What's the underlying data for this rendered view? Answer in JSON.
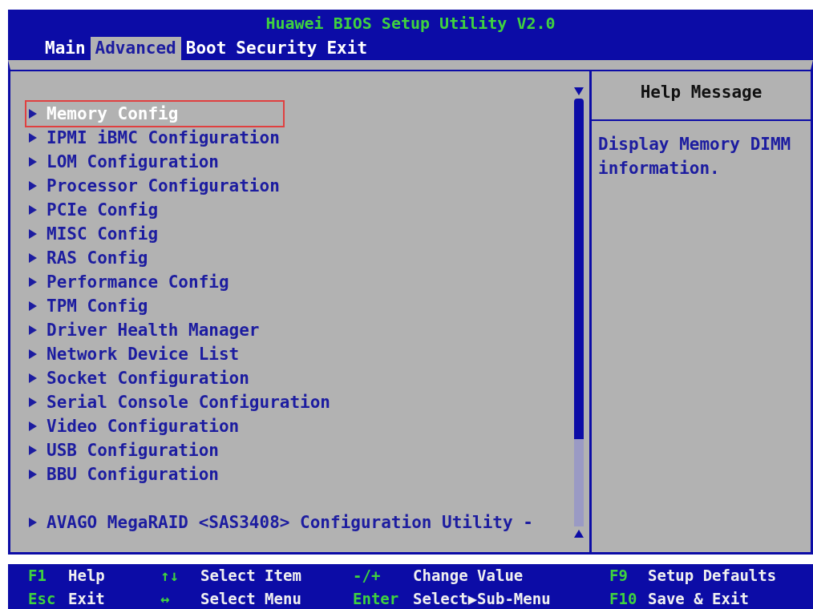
{
  "window": {
    "title": "Huawei BIOS Setup Utility V2.0"
  },
  "tabs": [
    {
      "label": "Main",
      "selected": false
    },
    {
      "label": "Advanced",
      "selected": true
    },
    {
      "label": "Boot",
      "selected": false
    },
    {
      "label": "Security",
      "selected": false
    },
    {
      "label": "Exit",
      "selected": false
    }
  ],
  "menu": {
    "items": [
      {
        "label": "Memory Config",
        "selected": true
      },
      {
        "label": "IPMI iBMC Configuration",
        "selected": false
      },
      {
        "label": "LOM Configuration",
        "selected": false
      },
      {
        "label": "Processor Configuration",
        "selected": false
      },
      {
        "label": "PCIe Config",
        "selected": false
      },
      {
        "label": "MISC Config",
        "selected": false
      },
      {
        "label": "RAS Config",
        "selected": false
      },
      {
        "label": "Performance Config",
        "selected": false
      },
      {
        "label": "TPM Config",
        "selected": false
      },
      {
        "label": "Driver Health Manager",
        "selected": false
      },
      {
        "label": "Network Device List",
        "selected": false
      },
      {
        "label": "Socket Configuration",
        "selected": false
      },
      {
        "label": "Serial Console Configuration",
        "selected": false
      },
      {
        "label": "Video Configuration",
        "selected": false
      },
      {
        "label": "USB Configuration",
        "selected": false
      },
      {
        "label": "BBU Configuration",
        "selected": false
      }
    ],
    "bottom_items": [
      {
        "label": "AVAGO MegaRAID <SAS3408> Configuration Utility -",
        "selected": false
      }
    ]
  },
  "help": {
    "title": "Help Message",
    "text": "Display Memory DIMM information."
  },
  "footer": [
    {
      "key": "F1",
      "label": "Help"
    },
    {
      "key": "↑↓",
      "label": "Select Item"
    },
    {
      "key": "-/+",
      "label": "Change Value"
    },
    {
      "key": "F9",
      "label": "Setup Defaults"
    },
    {
      "key": "Esc",
      "label": "Exit"
    },
    {
      "key": "↔",
      "label": "Select Menu"
    },
    {
      "key": "Enter",
      "label": "Select▶Sub-Menu"
    },
    {
      "key": "F10",
      "label": "Save & Exit"
    }
  ]
}
